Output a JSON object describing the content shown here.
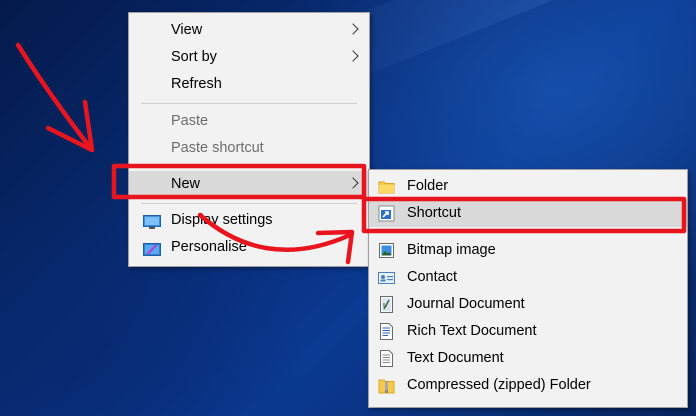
{
  "context_menu": {
    "items": [
      {
        "label": "View",
        "has_submenu": true,
        "enabled": true
      },
      {
        "label": "Sort by",
        "has_submenu": true,
        "enabled": true
      },
      {
        "label": "Refresh",
        "has_submenu": false,
        "enabled": true
      },
      {
        "label": "Paste",
        "has_submenu": false,
        "enabled": false
      },
      {
        "label": "Paste shortcut",
        "has_submenu": false,
        "enabled": false
      },
      {
        "label": "New",
        "has_submenu": true,
        "enabled": true,
        "highlighted": true
      },
      {
        "label": "Display settings",
        "icon": "display-icon",
        "enabled": true
      },
      {
        "label": "Personalise",
        "icon": "personalise-icon",
        "enabled": true
      }
    ]
  },
  "new_submenu": {
    "items": [
      {
        "label": "Folder",
        "icon": "folder-icon"
      },
      {
        "label": "Shortcut",
        "icon": "shortcut-icon",
        "highlighted": true
      },
      {
        "label": "Bitmap image",
        "icon": "bitmap-icon"
      },
      {
        "label": "Contact",
        "icon": "contact-icon"
      },
      {
        "label": "Journal Document",
        "icon": "journal-icon"
      },
      {
        "label": "Rich Text Document",
        "icon": "rich-text-icon"
      },
      {
        "label": "Text Document",
        "icon": "text-document-icon"
      },
      {
        "label": "Compressed (zipped) Folder",
        "icon": "zip-folder-icon"
      }
    ]
  },
  "annotation_color": "#e8141e",
  "menu_highlight_color": "#dadada"
}
